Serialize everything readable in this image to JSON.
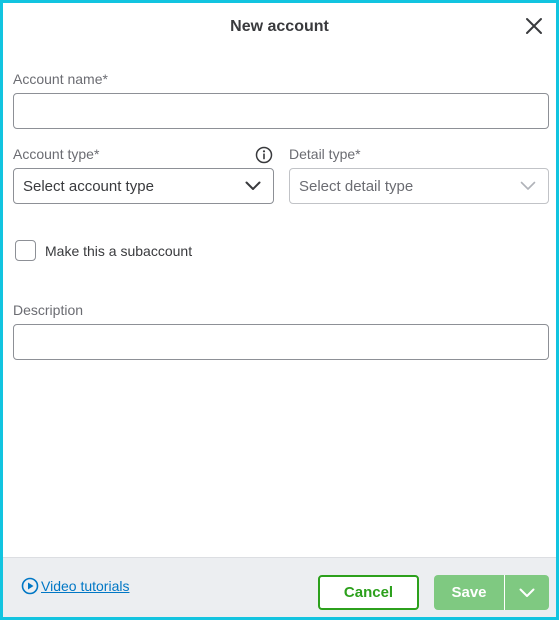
{
  "dialog": {
    "title": "New account",
    "close_icon": "close-icon"
  },
  "form": {
    "account_name": {
      "label": "Account name*",
      "value": ""
    },
    "account_type": {
      "label": "Account type*",
      "value": "Select account type",
      "info_icon": "info-icon"
    },
    "detail_type": {
      "label": "Detail type*",
      "value": "Select detail type",
      "disabled": true
    },
    "subaccount": {
      "label": "Make this a subaccount",
      "checked": false
    },
    "description": {
      "label": "Description",
      "value": ""
    }
  },
  "footer": {
    "video_tutorials_label": "Video tutorials",
    "cancel_label": "Cancel",
    "save_label": "Save"
  },
  "colors": {
    "accent_border": "#12c4e0",
    "primary_green": "#2ca01c",
    "save_disabled_green": "#7fc981",
    "link_blue": "#0077c5",
    "footer_bg": "#eceef1"
  }
}
